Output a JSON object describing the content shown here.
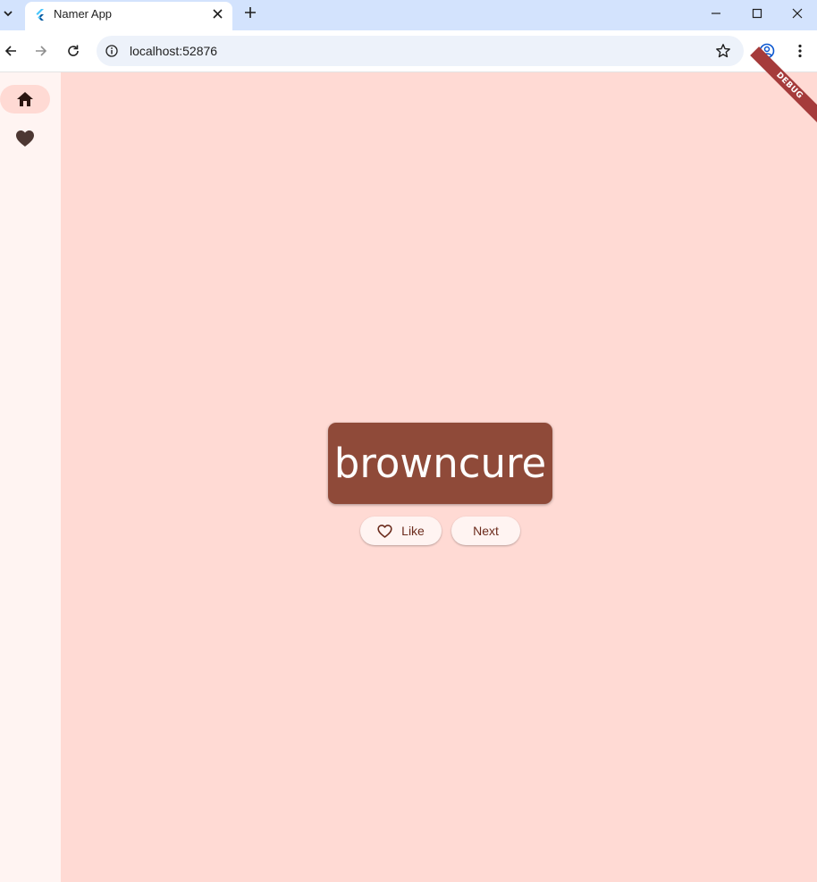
{
  "browser": {
    "tab": {
      "title": "Namer App",
      "favicon": "flutter-icon"
    },
    "url": "localhost:52876",
    "icons": {
      "tab_search": "chevron-down-icon",
      "close_tab": "close-icon",
      "new_tab": "plus-icon",
      "minimize": "minimize-icon",
      "maximize": "maximize-icon",
      "close_window": "close-icon",
      "back": "arrow-left-icon",
      "forward": "arrow-right-icon",
      "reload": "reload-icon",
      "site_info": "info-icon",
      "bookmark": "star-icon",
      "profile": "account-icon",
      "menu": "more-vertical-icon"
    }
  },
  "app": {
    "nav_rail": {
      "items": [
        {
          "icon": "home-icon",
          "selected": true
        },
        {
          "icon": "heart-icon",
          "selected": false
        }
      ]
    },
    "word_pair": "browncure",
    "buttons": {
      "like_label": "Like",
      "like_icon": "heart-outline-icon",
      "next_label": "Next"
    },
    "debug_banner": "DEBUG",
    "colors": {
      "background": "#ffdad4",
      "rail": "#fff4f2",
      "card": "#8f4a39",
      "button_text": "#6b2b1c"
    }
  }
}
